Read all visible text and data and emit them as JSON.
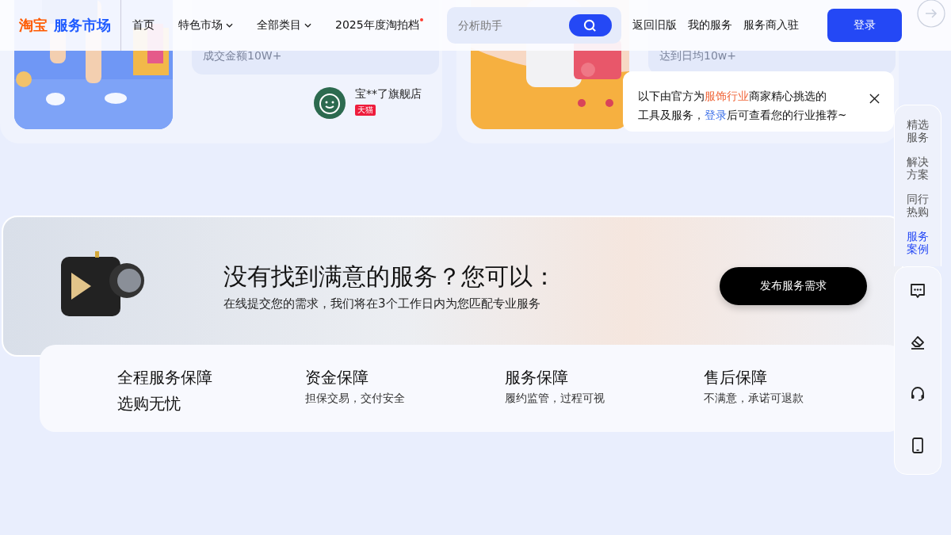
{
  "header": {
    "logo": {
      "brand": "淘宝",
      "product": "服务市场"
    },
    "nav": [
      {
        "label": "首页",
        "has_menu": false,
        "dot": false
      },
      {
        "label": "特色市场",
        "has_menu": true,
        "dot": false
      },
      {
        "label": "全部类目",
        "has_menu": true,
        "dot": false
      },
      {
        "label": "2025年度淘拍档",
        "has_menu": false,
        "dot": true
      }
    ],
    "search": {
      "placeholder": "分析助手"
    },
    "links": [
      "返回旧版",
      "我的服务",
      "服务商入驻"
    ],
    "login_button": "登录"
  },
  "case_cards": [
    {
      "quote": "成交金额10W+",
      "shop": {
        "name": "宝**了旗舰店",
        "badge": "天猫"
      }
    },
    {
      "quote": "达到日均10w+"
    }
  ],
  "popup": {
    "industry": "服饰行业",
    "line1_before": "以下由官方为",
    "line1_after": "商家精心挑选的",
    "line2_before": "工具及服务，",
    "link": "登录",
    "line2_after": "后可查看您的行业推荐~"
  },
  "banner": {
    "title": "没有找到满意的服务？您可以：",
    "subtitle": "在线提交您的需求，我们将在3个工作日内为您匹配专业服务",
    "button": "发布服务需求"
  },
  "guarantees": [
    {
      "kind": "headline",
      "title": "全程服务保障",
      "subtitle": "选购无忧"
    },
    {
      "kind": "item",
      "title": "资金保障",
      "subtitle": "担保交易，交付安全"
    },
    {
      "kind": "item",
      "title": "服务保障",
      "subtitle": "履约监管，过程可视"
    },
    {
      "kind": "item",
      "title": "售后保障",
      "subtitle": "不满意，承诺可退款"
    }
  ],
  "side_nav": [
    {
      "label": "精选服务",
      "selected": false
    },
    {
      "label": "解决方案",
      "selected": false
    },
    {
      "label": "同行热购",
      "selected": false
    },
    {
      "label": "服务案例",
      "selected": true
    }
  ],
  "side_tools": [
    {
      "kind": "chat"
    },
    {
      "kind": "edit"
    },
    {
      "kind": "support"
    },
    {
      "kind": "phone"
    }
  ]
}
